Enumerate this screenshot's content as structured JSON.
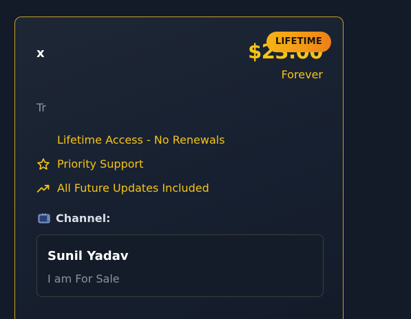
{
  "plan": {
    "name": "x",
    "price": "$23.00",
    "badge": "LIFETIME",
    "period": "Forever",
    "description": "Tr"
  },
  "features": [
    {
      "icon": "none",
      "label": "Lifetime Access - No Renewals"
    },
    {
      "icon": "star-icon",
      "label": "Priority Support"
    },
    {
      "icon": "trending-up-icon",
      "label": "All Future Updates Included"
    }
  ],
  "channel": {
    "label": "Channel:",
    "icon": "tv-icon",
    "name": "Sunil Yadav",
    "description": "I am For Sale"
  },
  "colors": {
    "accent": "#f5c518",
    "border": "#c9a227",
    "background": "#131a28"
  }
}
